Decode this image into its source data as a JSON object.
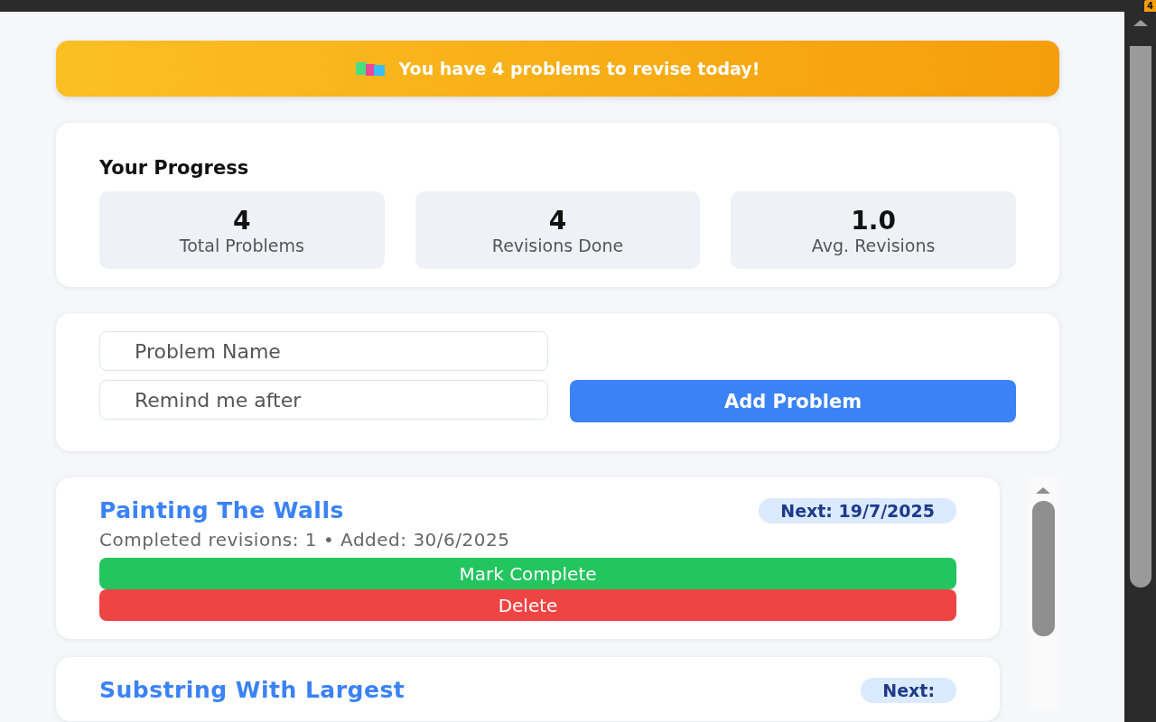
{
  "browser": {
    "badge": "4"
  },
  "banner": {
    "text": "You have 4 problems to revise today!"
  },
  "progress": {
    "title": "Your Progress",
    "stats": [
      {
        "value": "4",
        "label": "Total Problems"
      },
      {
        "value": "4",
        "label": "Revisions Done"
      },
      {
        "value": "1.0",
        "label": "Avg. Revisions"
      }
    ]
  },
  "form": {
    "name_placeholder": "Problem Name",
    "days_placeholder": "Remind me after",
    "add_button": "Add Problem"
  },
  "problems": [
    {
      "title": "Painting The Walls",
      "next": "Next: 19/7/2025",
      "meta": "Completed revisions: 1 • Added: 30/6/2025",
      "complete_button": "Mark Complete",
      "delete_button": "Delete"
    },
    {
      "title": "Substring With Largest",
      "next": "Next:"
    }
  ]
}
